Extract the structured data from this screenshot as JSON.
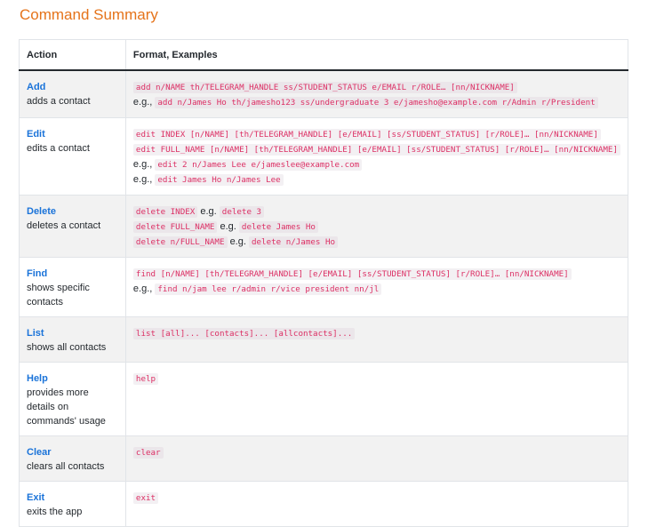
{
  "page": {
    "title": "Command Summary"
  },
  "table": {
    "headers": [
      "Action",
      "Format, Examples"
    ],
    "rows": [
      {
        "name": "Add",
        "desc": "adds a contact",
        "lines": [
          {
            "prefix": "",
            "code": "add n/NAME th/TELEGRAM_HANDLE ss/STUDENT_STATUS e/EMAIL r/ROLE… [nn/NICKNAME]",
            "mid": "",
            "code2": ""
          },
          {
            "prefix": "e.g.,",
            "code": "add n/James Ho th/jamesho123 ss/undergraduate 3 e/jamesho@example.com r/Admin r/President",
            "mid": "",
            "code2": ""
          }
        ]
      },
      {
        "name": "Edit",
        "desc": "edits a contact",
        "lines": [
          {
            "prefix": "",
            "code": "edit INDEX [n/NAME] [th/TELEGRAM_HANDLE] [e/EMAIL] [ss/STUDENT_STATUS] [r/ROLE]… [nn/NICKNAME]",
            "mid": "",
            "code2": ""
          },
          {
            "prefix": "",
            "code": "edit FULL_NAME [n/NAME] [th/TELEGRAM_HANDLE] [e/EMAIL] [ss/STUDENT_STATUS] [r/ROLE]… [nn/NICKNAME]",
            "mid": "",
            "code2": ""
          },
          {
            "prefix": "e.g.,",
            "code": "edit 2 n/James Lee e/jameslee@example.com",
            "mid": "",
            "code2": ""
          },
          {
            "prefix": "e.g.,",
            "code": "edit James Ho n/James Lee",
            "mid": "",
            "code2": ""
          }
        ]
      },
      {
        "name": "Delete",
        "desc": "deletes a contact",
        "lines": [
          {
            "prefix": "",
            "code": "delete INDEX",
            "mid": "e.g.",
            "code2": "delete 3"
          },
          {
            "prefix": "",
            "code": "delete FULL_NAME",
            "mid": "e.g.",
            "code2": "delete James Ho"
          },
          {
            "prefix": "",
            "code": "delete n/FULL_NAME",
            "mid": "e.g.",
            "code2": "delete n/James Ho"
          }
        ]
      },
      {
        "name": "Find",
        "desc": "shows specific contacts",
        "lines": [
          {
            "prefix": "",
            "code": "find [n/NAME] [th/TELEGRAM_HANDLE] [e/EMAIL] [ss/STUDENT_STATUS] [r/ROLE]… [nn/NICKNAME]",
            "mid": "",
            "code2": ""
          },
          {
            "prefix": "e.g.,",
            "code": "find n/jam lee r/admin r/vice president nn/jl",
            "mid": "",
            "code2": ""
          }
        ]
      },
      {
        "name": "List",
        "desc": "shows all contacts",
        "lines": [
          {
            "prefix": "",
            "code": "list [all]... [contacts]... [allcontacts]...",
            "mid": "",
            "code2": ""
          }
        ]
      },
      {
        "name": "Help",
        "desc": "provides more details on commands' usage",
        "lines": [
          {
            "prefix": "",
            "code": "help",
            "mid": "",
            "code2": ""
          }
        ]
      },
      {
        "name": "Clear",
        "desc": "clears all contacts",
        "lines": [
          {
            "prefix": "",
            "code": "clear",
            "mid": "",
            "code2": ""
          }
        ]
      },
      {
        "name": "Exit",
        "desc": "exits the app",
        "lines": [
          {
            "prefix": "",
            "code": "exit",
            "mid": "",
            "code2": ""
          }
        ]
      }
    ]
  }
}
